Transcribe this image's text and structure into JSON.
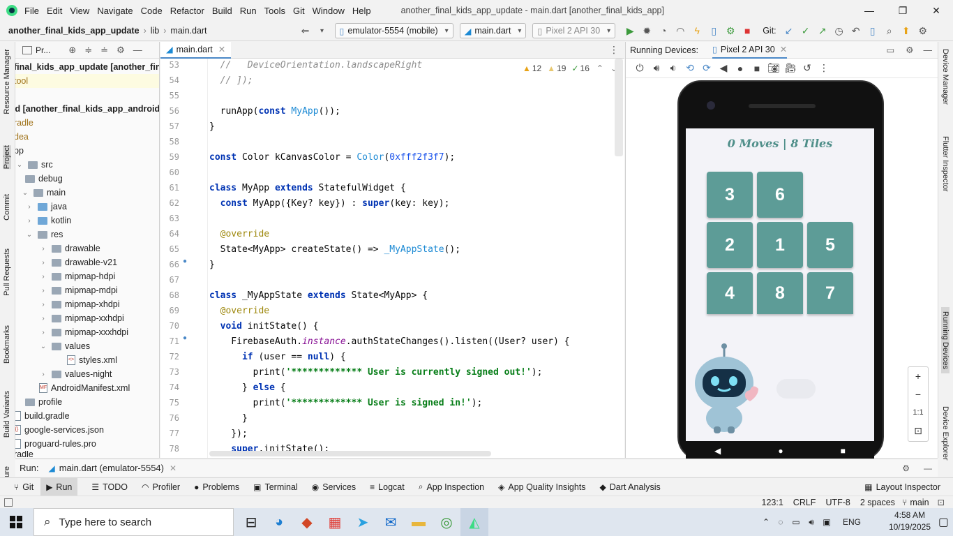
{
  "menubar": {
    "items": [
      "File",
      "Edit",
      "View",
      "Navigate",
      "Code",
      "Refactor",
      "Build",
      "Run",
      "Tools",
      "Git",
      "Window",
      "Help"
    ],
    "title": "another_final_kids_app_update - main.dart [another_final_kids_app]"
  },
  "navbar": {
    "project": "another_final_kids_app_update",
    "sep1": "lib",
    "file": "main.dart",
    "device": "emulator-5554 (mobile)",
    "runconfig": "main.dart",
    "avd": "Pixel 2 API 30",
    "git_label": "Git:"
  },
  "project_panel": {
    "title": "Pr...",
    "items": [
      {
        "label": "final_kids_app_update [another_final_ki",
        "bold": true
      },
      {
        "label": "tool"
      },
      {
        "label": "id [another_final_kids_app_android]",
        "bold": true
      },
      {
        "label": "radle"
      },
      {
        "label": "dea"
      },
      {
        "label": "pp"
      },
      {
        "label": "src"
      },
      {
        "label": "debug"
      },
      {
        "label": "main"
      },
      {
        "label": "java"
      },
      {
        "label": "kotlin"
      },
      {
        "label": "res"
      },
      {
        "label": "drawable"
      },
      {
        "label": "drawable-v21"
      },
      {
        "label": "mipmap-hdpi"
      },
      {
        "label": "mipmap-mdpi"
      },
      {
        "label": "mipmap-xhdpi"
      },
      {
        "label": "mipmap-xxhdpi"
      },
      {
        "label": "mipmap-xxxhdpi"
      },
      {
        "label": "values"
      },
      {
        "label": "styles.xml"
      },
      {
        "label": "values-night"
      },
      {
        "label": "AndroidManifest.xml"
      },
      {
        "label": "profile"
      },
      {
        "label": "build.gradle"
      },
      {
        "label": "google-services.json"
      },
      {
        "label": "proguard-rules.pro"
      },
      {
        "label": "radle"
      }
    ]
  },
  "left_tools": [
    "Resource Manager",
    "Project",
    "Commit",
    "Pull Requests",
    "Bookmarks",
    "Build Variants",
    "Structure"
  ],
  "right_tools": [
    "Device Manager",
    "Flutter Inspector",
    "Running Devices",
    "Device Explorer"
  ],
  "editor": {
    "tab": "main.dart",
    "warn_a": "12",
    "warn_b": "19",
    "ok": "16",
    "line_numbers": [
      "53",
      "54",
      "55",
      "56",
      "57",
      "58",
      "59",
      "60",
      "61",
      "62",
      "63",
      "64",
      "65",
      "66",
      "67",
      "68",
      "69",
      "70",
      "71",
      "72",
      "73",
      "74",
      "75",
      "76",
      "77",
      "78"
    ]
  },
  "device_panel": {
    "title": "Running Devices:",
    "tab": "Pixel 2 API 30",
    "game_title": "0 Moves | 8 Tiles",
    "tiles": [
      "3",
      "6",
      "2",
      "1",
      "5",
      "4",
      "8",
      "7"
    ],
    "zoom": [
      "+",
      "−",
      "1:1",
      "⊡"
    ]
  },
  "runbar": {
    "label": "Run:",
    "config": "main.dart (emulator-5554)"
  },
  "bottom_tools": [
    "Git",
    "Run",
    "TODO",
    "Profiler",
    "Problems",
    "Terminal",
    "Services",
    "Logcat",
    "App Inspection",
    "App Quality Insights",
    "Dart Analysis"
  ],
  "bottom_right": "Layout Inspector",
  "status": {
    "pos": "123:1",
    "eol": "CRLF",
    "enc": "UTF-8",
    "indent": "2 spaces",
    "branch": "main"
  },
  "taskbar": {
    "search": "Type here to search",
    "lang": "ENG",
    "time": "4:58 AM",
    "date": "10/19/2025"
  },
  "colors": {
    "tile": "#5d9c97",
    "accent": "#4a88c7"
  }
}
